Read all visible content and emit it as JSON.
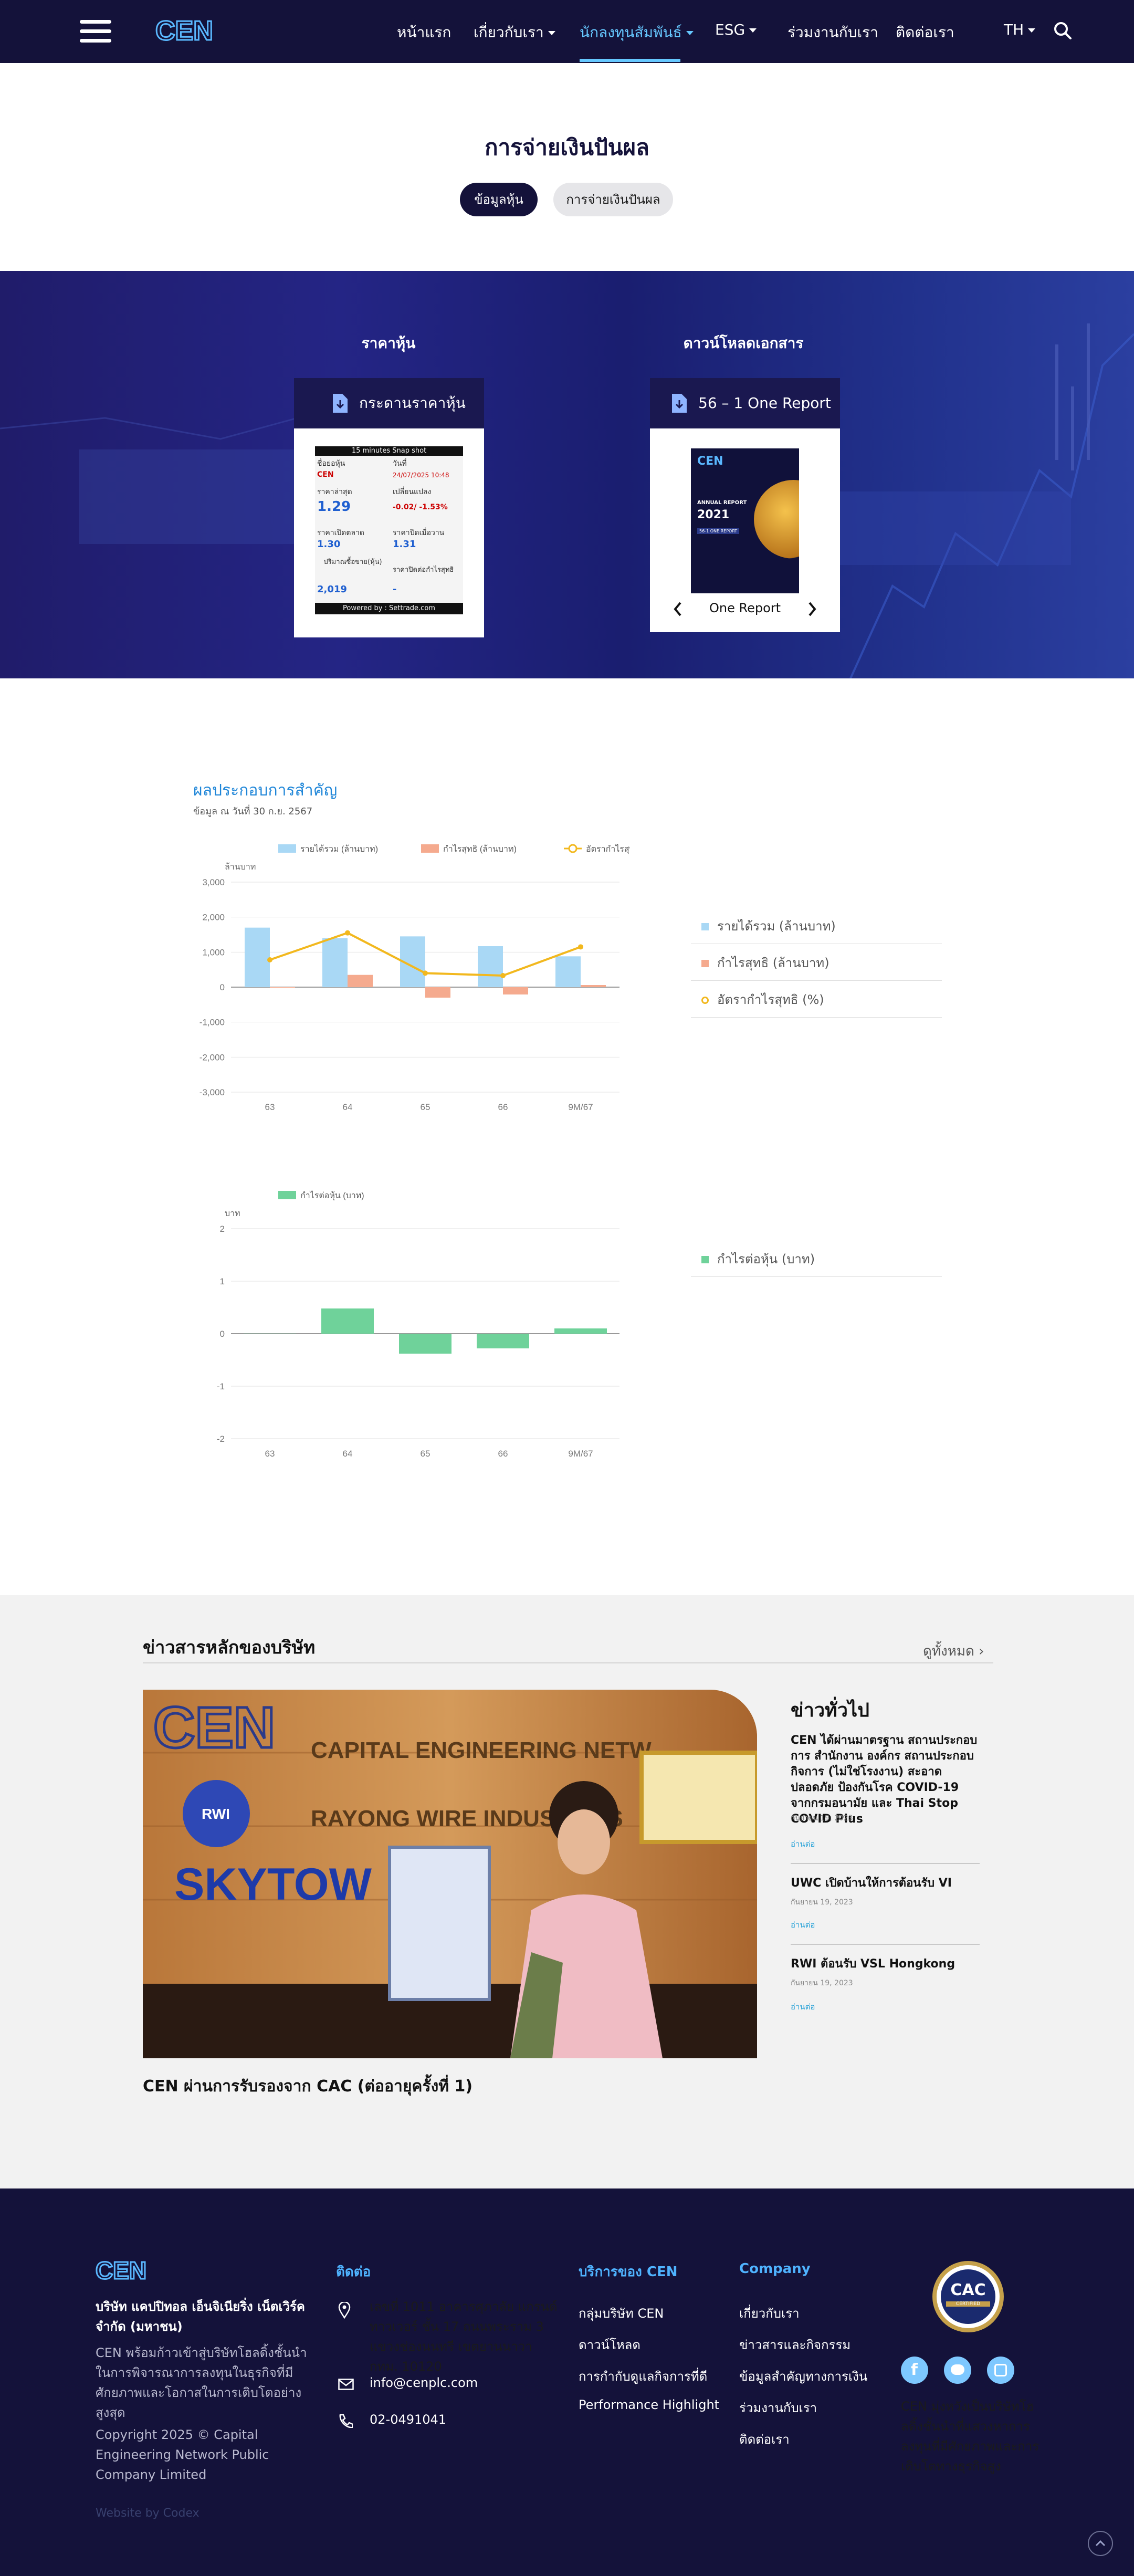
{
  "nav": {
    "logo": "CEN",
    "items": [
      {
        "label": "หน้าแรก"
      },
      {
        "label": "เกี่ยวกับเรา"
      },
      {
        "label": "นักลงทุนสัมพันธ์"
      },
      {
        "label": "ESG"
      },
      {
        "label": "ร่วมงานกับเรา"
      },
      {
        "label": "ติดต่อเรา"
      }
    ],
    "lang": "TH"
  },
  "hero": {
    "title": "การจ่ายเงินปันผล",
    "tabs": [
      {
        "label": "ข้อมูลหุ้น"
      },
      {
        "label": "การจ่ายเงินปันผล"
      }
    ]
  },
  "band": {
    "stock_heading": "ราคาหุ้น",
    "docs_heading": "ดาวน์โหลดเอกสาร",
    "stock_card": {
      "title": "กระดานราคาหุ้น",
      "snapshot": "15 minutes Snap shot",
      "symbol_label": "ชื่อย่อหุ้น",
      "date_label": "วันที่",
      "symbol": "CEN",
      "date": "24/07/2025 10:48",
      "last_label": "ราคาล่าสุด",
      "change_label": "เปลี่ยนแปลง",
      "last": "1.29",
      "change": "-0.02/ -1.53%",
      "open_label": "ราคาเปิดตลาด",
      "prev_label": "ราคาปิดเมื่อวาน",
      "open": "1.30",
      "prev": "1.31",
      "volume_label": "ปริมาณซื้อขาย(หุ้น)",
      "bid_label": "ราคาปิดต่อกำไรสุทธิ",
      "volume": "2,019",
      "bid": "-",
      "powered": "Powered by : Settrade.com"
    },
    "doc_card": {
      "title": "56 – 1 One Report",
      "cover_heading": "ANNUAL REPORT",
      "cover_year": "2021",
      "cover_tag": "56-1 ONE REPORT",
      "caption": "One Report"
    }
  },
  "performance": {
    "title": "ผลประกอบการสำคัญ",
    "subtitle": "ข้อมูล ณ วันที่ 30 ก.ย. 2567",
    "side_legend_1": [
      "รายได้รวม (ล้านบาท)",
      "กำไรสุทธิ (ล้านบาท)",
      "อัตรากำไรสุทธิ (%)"
    ],
    "side_legend_2": [
      "กำไรต่อหุ้น (บาท)"
    ]
  },
  "chart_data": [
    {
      "type": "bar",
      "ylabel": "ล้านบาท",
      "categories": [
        "63",
        "64",
        "65",
        "66",
        "9M/67"
      ],
      "ylim": [
        -3000,
        3000
      ],
      "yticks": [
        "3,000",
        "2,000",
        "1,000",
        "0",
        "-1,000",
        "-2,000",
        "-3,000"
      ],
      "series": [
        {
          "name": "รายได้รวม (ล้านบาท)",
          "kind": "bar",
          "color": "#a9d8f5",
          "values": [
            1700,
            1400,
            1450,
            1170,
            880
          ]
        },
        {
          "name": "กำไรสุทธิ (ล้านบาท)",
          "kind": "bar",
          "color": "#f5aa8e",
          "values": [
            0,
            350,
            -300,
            -210,
            60
          ]
        },
        {
          "name": "อัตรากำไรสุทธิ (%)",
          "kind": "line",
          "color": "#f2b81e",
          "values": [
            780,
            1550,
            400,
            330,
            1150
          ]
        }
      ],
      "grid": true,
      "legend": "top"
    },
    {
      "type": "bar",
      "ylabel": "บาท",
      "categories": [
        "63",
        "64",
        "65",
        "66",
        "9M/67"
      ],
      "ylim": [
        -2,
        2
      ],
      "yticks": [
        "2",
        "1",
        "0",
        "-1",
        "-2"
      ],
      "series": [
        {
          "name": "กำไรต่อหุ้น (บาท)",
          "kind": "bar",
          "color": "#6fd29a",
          "values": [
            0,
            0.48,
            -0.38,
            -0.28,
            0.1
          ]
        }
      ],
      "grid": true,
      "legend": "top"
    }
  ],
  "news": {
    "title": "ข่าวสารหลักของบริษัท",
    "see_all": "ดูทั้งหมด",
    "main_caption": "CEN ผ่านการรับรองจาก CAC (ต่ออายุครั้งที่ 1)",
    "photo_text": {
      "sign1": "CAPITAL ENGINEERING NETW",
      "sign2": "RAYONG WIRE INDUSTRIES",
      "sign3": "SKYTOW",
      "rwi": "RWI"
    },
    "side_title": "ข่าวทั่วไป",
    "side_items": [
      {
        "title": "CEN ได้ผ่านมาตรฐาน สถานประกอบการ สำนักงาน องค์กร สถานประกอบกิจการ (ไม่ใช่โรงงาน) สะอาดปลอดภัย ป้องกันโรค COVID-19 จากกรมอนามัย และ Thai Stop COVID Plus",
        "date": "กันยายน 19, 2023",
        "more": "อ่านต่อ"
      },
      {
        "title": "UWC เปิดบ้านให้การต้อนรับ VI",
        "date": "กันยายน 19, 2023",
        "more": "อ่านต่อ"
      },
      {
        "title": "RWI ต้อนรับ VSL Hongkong",
        "date": "กันยายน 19, 2023",
        "more": "อ่านต่อ"
      }
    ]
  },
  "footer": {
    "company_name": "บริษัท แคปปิทอล เอ็นจิเนียริ่ง เน็ตเวิร์ค จำกัด (มหาชน)",
    "company_desc": "CEN พร้อมก้าวเข้าสู่บริษัทโฮลดิ้งชั้นนำในการพิจารณาการลงทุนในธุรกิจที่มีศักยภาพและโอกาสในการเติบโตอย่างสูงสุด",
    "copyright": "Copyright 2025 © Capital Engineering Network Public Company Limited",
    "credit": "Website by Codex",
    "contact_heading": "ติดต่อ",
    "address": "เลขที่ 1011 อาคารศุภาลัย แกรนด์ ทาวเวอร์ ชั้น 17 ถนนพระราม 3 แขวงช่องนนทรี เขตยานนาวา กทม. 10120",
    "email": "info@cenplc.com",
    "phone": "02-0491041",
    "services_heading": "บริการของ CEN",
    "services": [
      "กลุ่มบริษัท CEN",
      "ดาวน์โหลด",
      "การกำกับดูแลกิจการที่ดี",
      "Performance Highlight"
    ],
    "company_heading": "Company",
    "company_links": [
      "เกี่ยวกับเรา",
      "ข่าวสารและกิจกรรม",
      "ข้อมูลสำคัญทางการเงิน",
      "ร่วมงานกับเรา",
      "ติดต่อเรา"
    ],
    "cac_label": "CAC",
    "cac_sub": "CERTIFIED",
    "tagline": "CEN มุ่งหวังเป็นบริษัทโฮลดิ้งชั้นนำที่แสวงหาการลงทุนที่มีศักยภาพและการเติบโตทางธุรกิจสูง"
  }
}
